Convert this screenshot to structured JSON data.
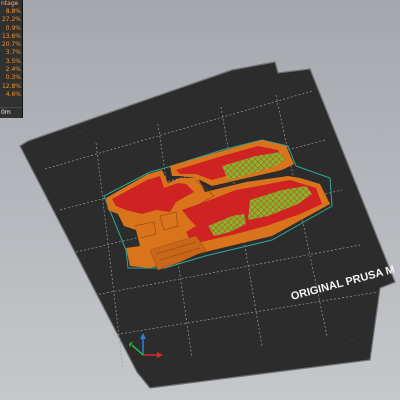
{
  "legend": {
    "header": "ntage",
    "values": [
      "8.8%",
      "27.2%",
      "0.9%",
      "13.6%",
      "20.7%",
      "3.7%",
      "3.5%",
      "2.4%",
      "0.3%",
      "12.8%",
      "4.6%"
    ],
    "unit_text": "0m"
  },
  "bed": {
    "brand_text": "ORIGINAL PRUSA M"
  },
  "colors": {
    "bed": "#2c2c2c",
    "perimeter": "#d9731c",
    "solid_infill": "#cf2222",
    "sparse_infill": "#7fb832"
  },
  "icons": {
    "axis_gizmo": "xyz-axes-icon"
  }
}
